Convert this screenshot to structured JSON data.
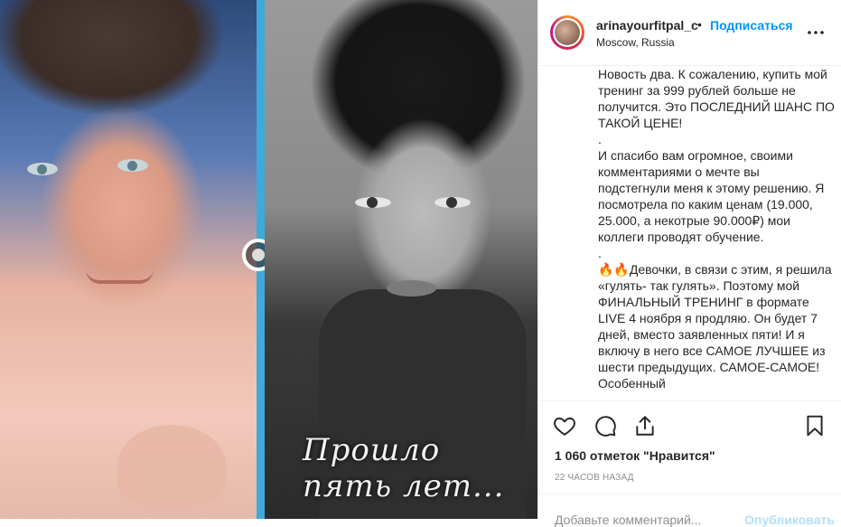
{
  "post": {
    "image_overlay_text": "Прошло пять лет...",
    "divider_handle_icon": "slider-handle-icon"
  },
  "header": {
    "username": "arinayourfitpal_c",
    "separator": "•",
    "follow_label": "Подписаться",
    "location": "Moscow, Russia",
    "more_icon": "more-options-icon"
  },
  "caption": {
    "lines": [
      "Новость два. К сожалению, купить мой тренинг за 999 рублей больше не получится. Это ПОСЛЕДНИЙ ШАНС ПО ТАКОЙ ЦЕНЕ!",
      ".",
      "И спасибо вам огромное, своими комментариями о мечте вы подстегнули меня к этому решению. Я посмотрела по каким ценам (19.000, 25.000, а некотрые 90.000₽) мои коллеги проводят обучение.",
      ".",
      "🔥🔥Девочки, в связи с этим, я решила «гулять- так гулять». Поэтому мой ФИНАЛЬНЫЙ ТРЕНИНГ в формате LIVE 4 ноября я продляю. Он будет 7 дней, вместо заявленных пяти! И я включу в него все САМОЕ ЛУЧШЕЕ из шести предыдущих. САМОЕ-САМОЕ!",
      "Особенный"
    ]
  },
  "actions": {
    "icons": [
      "heart-icon",
      "comment-icon",
      "share-icon",
      "bookmark-icon"
    ],
    "likes_text": "1 060 отметок \"Нравится\"",
    "timestamp": "22 ЧАСОВ НАЗАД"
  },
  "comment": {
    "placeholder": "Добавьте комментарий...",
    "publish_label": "Опубликовать"
  },
  "colors": {
    "accent": "#0095f6",
    "publish_disabled": "#b2dffc",
    "divider": "#3fa9d9",
    "text": "#262626",
    "muted": "#8e8e8e"
  }
}
